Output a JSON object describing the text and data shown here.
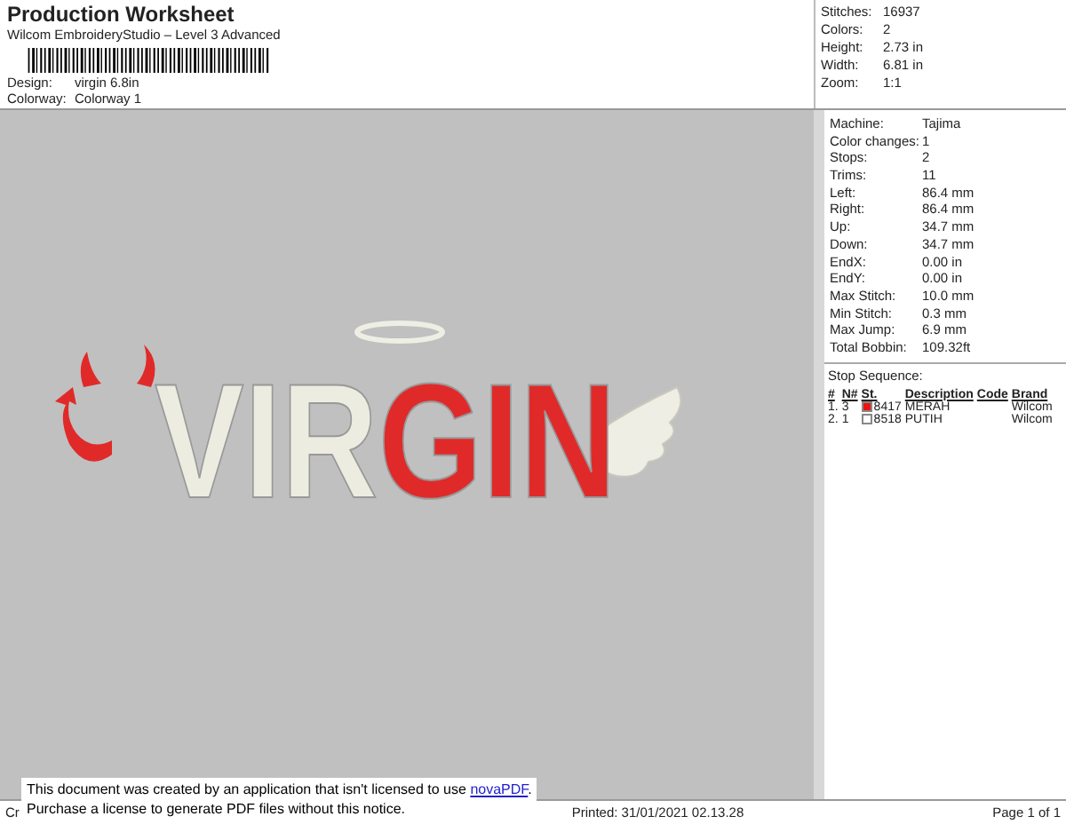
{
  "header": {
    "title": "Production Worksheet",
    "subtitle": "Wilcom EmbroideryStudio – Level 3 Advanced",
    "fields": [
      {
        "label": "Design:",
        "value": "virgin 6.8in"
      },
      {
        "label": "Colorway:",
        "value": "Colorway 1"
      }
    ]
  },
  "summary": [
    {
      "label": "Stitches:",
      "value": "16937"
    },
    {
      "label": "Colors:",
      "value": "2"
    },
    {
      "label": "Height:",
      "value": "2.73 in"
    },
    {
      "label": "Width:",
      "value": "6.81 in"
    },
    {
      "label": "Zoom:",
      "value": "1:1"
    }
  ],
  "design": {
    "parts": [
      {
        "text": "VIR",
        "color": "#ecece0"
      },
      {
        "text": "GIN",
        "color": "#e02a2a"
      }
    ]
  },
  "details": [
    {
      "label": "Machine:",
      "value": "Tajima"
    },
    {
      "label": "Color changes:",
      "value": "1"
    },
    {
      "label": "Stops:",
      "value": "2"
    },
    {
      "label": "Trims:",
      "value": "11"
    },
    {
      "label": "Left:",
      "value": "86.4 mm"
    },
    {
      "label": "Right:",
      "value": "86.4 mm"
    },
    {
      "label": "Up:",
      "value": "34.7 mm"
    },
    {
      "label": "Down:",
      "value": "34.7 mm"
    },
    {
      "label": "EndX:",
      "value": "0.00 in"
    },
    {
      "label": "EndY:",
      "value": "0.00 in"
    },
    {
      "label": "Max Stitch:",
      "value": "10.0 mm"
    },
    {
      "label": "Min Stitch:",
      "value": "0.3 mm"
    },
    {
      "label": "Max Jump:",
      "value": "6.9 mm"
    },
    {
      "label": "Total Bobbin:",
      "value": "109.32ft"
    }
  ],
  "stop_sequence": {
    "title": "Stop Sequence:",
    "columns": [
      "#",
      "N#",
      "St.",
      "Description",
      "Code",
      "Brand"
    ],
    "rows": [
      {
        "index": "1.",
        "needle": "3",
        "color": "#ee1111",
        "stitches": "8417",
        "description": "MERAH",
        "code": "",
        "brand": "Wilcom"
      },
      {
        "index": "2.",
        "needle": "1",
        "color": "#ffffff",
        "stitches": "8518",
        "description": "PUTIH",
        "code": "",
        "brand": "Wilcom"
      }
    ]
  },
  "footer": {
    "left": "Cr",
    "printed": "Printed: 31/01/2021 02.13.28",
    "page": "Page 1 of 1"
  },
  "notice": {
    "line1": "This document was created by an application that isn't licensed to use",
    "link": "novaPDF",
    "line1_end": ".",
    "line2": "Purchase a license to generate PDF files without this notice."
  }
}
